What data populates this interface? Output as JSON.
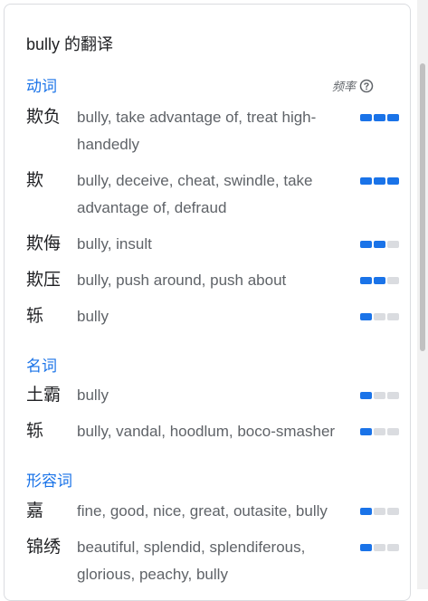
{
  "title": "bully 的翻译",
  "frequency_label": "频率",
  "colors": {
    "accent": "#1a73e8",
    "bar_off": "#dadce0"
  },
  "sections": [
    {
      "label": "动词",
      "rows": [
        {
          "term": "欺负",
          "meanings": "bully, take advantage of, treat high-handedly",
          "frequency": 3
        },
        {
          "term": "欺",
          "meanings": "bully, deceive, cheat, swindle, take advantage of, defraud",
          "frequency": 3
        },
        {
          "term": "欺侮",
          "meanings": "bully, insult",
          "frequency": 2
        },
        {
          "term": "欺压",
          "meanings": "bully, push around, push about",
          "frequency": 2
        },
        {
          "term": "轹",
          "meanings": "bully",
          "frequency": 1
        }
      ]
    },
    {
      "label": "名词",
      "rows": [
        {
          "term": "土霸",
          "meanings": "bully",
          "frequency": 1
        },
        {
          "term": "轹",
          "meanings": "bully, vandal, hoodlum, boco-smasher",
          "frequency": 1
        }
      ]
    },
    {
      "label": "形容词",
      "rows": [
        {
          "term": "嘉",
          "meanings": "fine, good, nice, great, outasite, bully",
          "frequency": 1
        },
        {
          "term": "锦绣",
          "meanings": "beautiful, splendid, splendiferous, glorious, peachy, bully",
          "frequency": 1
        }
      ]
    }
  ]
}
